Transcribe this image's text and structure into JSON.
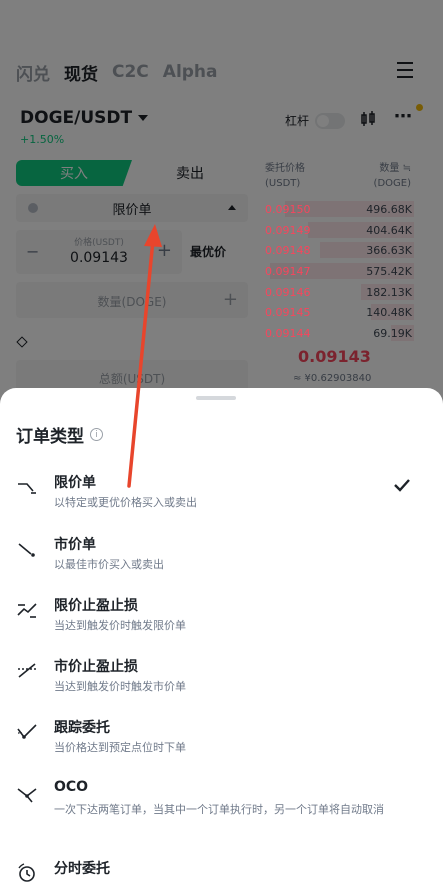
{
  "top_tabs": [
    "闪兑",
    "现货",
    "C2C",
    "Alpha"
  ],
  "active_tab_index": 1,
  "pair": {
    "symbol": "DOGE/USDT",
    "change": "+1.50%"
  },
  "header": {
    "leverage_label": "杠杆"
  },
  "trade": {
    "buy_label": "买入",
    "sell_label": "卖出",
    "order_type": "限价单",
    "price_label": "价格(USDT)",
    "price_value": "0.09143",
    "best_price_label": "最优价",
    "qty_placeholder": "数量(DOGE)",
    "total_placeholder": "总额(USDT)"
  },
  "orderbook": {
    "price_header": "委托价格",
    "price_unit": "(USDT)",
    "qty_header": "数量",
    "qty_unit": "(DOGE)",
    "asks": [
      {
        "price": "0.09150",
        "qty": "496.68K",
        "depth": 0.85
      },
      {
        "price": "0.09149",
        "qty": "404.64K",
        "depth": 0.7
      },
      {
        "price": "0.09148",
        "qty": "366.63K",
        "depth": 0.62
      },
      {
        "price": "0.09147",
        "qty": "575.42K",
        "depth": 0.95
      },
      {
        "price": "0.09146",
        "qty": "182.13K",
        "depth": 0.35
      },
      {
        "price": "0.09145",
        "qty": "140.48K",
        "depth": 0.28
      },
      {
        "price": "0.09144",
        "qty": "69.19K",
        "depth": 0.15
      }
    ],
    "last_price": "0.09143",
    "last_price_usd": "≈ ¥0.62903840"
  },
  "sheet": {
    "title": "订单类型",
    "info_glyph": "i",
    "selected_index": 0,
    "options": [
      {
        "title": "限价单",
        "desc": "以特定或更优价格买入或卖出",
        "icon": "limit-order-icon"
      },
      {
        "title": "市价单",
        "desc": "以最佳市价买入或卖出",
        "icon": "market-order-icon"
      },
      {
        "title": "限价止盈止损",
        "desc": "当达到触发价时触发限价单",
        "icon": "stop-limit-icon"
      },
      {
        "title": "市价止盈止损",
        "desc": "当达到触发价时触发市价单",
        "icon": "stop-market-icon"
      },
      {
        "title": "跟踪委托",
        "desc": "当价格达到预定点位时下单",
        "icon": "trailing-stop-icon"
      },
      {
        "title": "OCO",
        "desc": "一次下达两笔订单，当其中一个订单执行时，另一个订单将自动取消",
        "icon": "oco-icon"
      },
      {
        "title": "分时委托",
        "desc": "",
        "icon": "twap-icon"
      }
    ]
  },
  "colors": {
    "buy": "#0ecb81",
    "sell": "#f6465d",
    "annotation": "#e8452c"
  }
}
